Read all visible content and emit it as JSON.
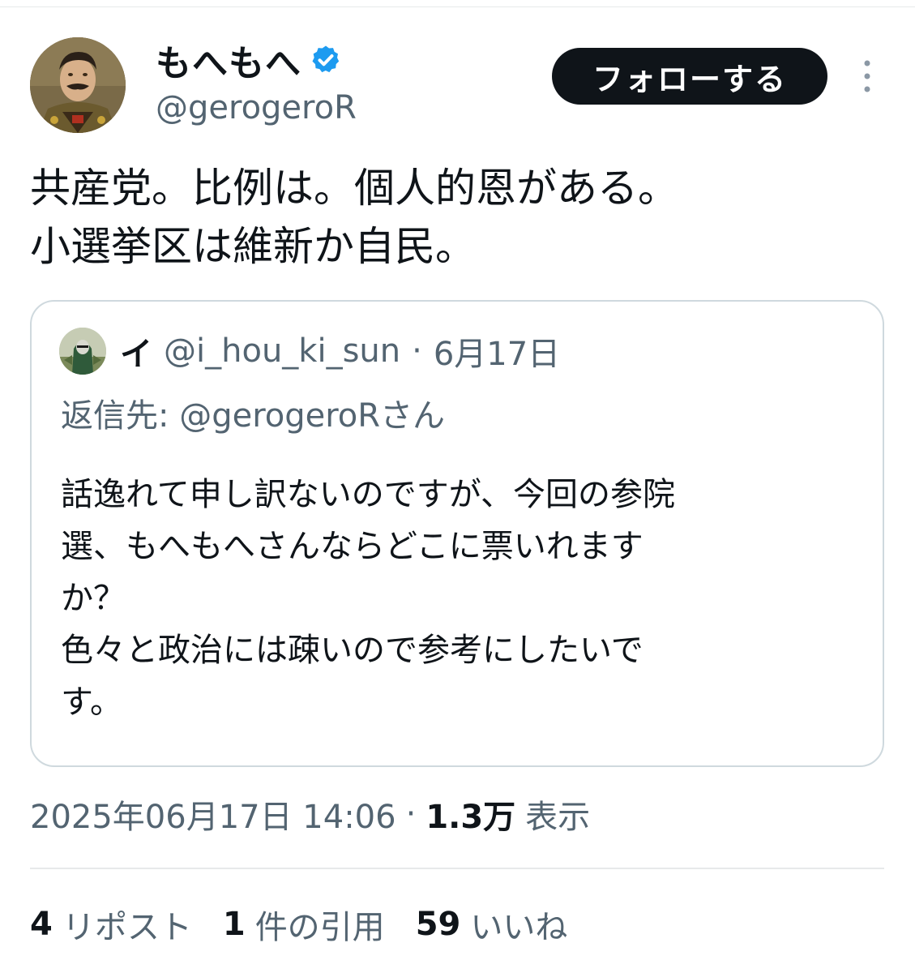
{
  "author": {
    "display_name": "もへもへ",
    "handle": "@gerogeroR",
    "verified": true,
    "avatar_icon": "portrait-avatar"
  },
  "follow_label": "フォローする",
  "more_icon": "more-vertical-icon",
  "tweet_text": "共産党。比例は。個人的恩がある。\n小選挙区は維新か自民。",
  "quote": {
    "display_name": "イ",
    "handle": "@i_hou_ki_sun",
    "separator": "·",
    "date": "6月17日",
    "reply_to": "返信先: @gerogeroRさん",
    "text": "話逸れて申し訳ないのですが、今回の参院\n選、もへもへさんならどこに票いれます\nか？\n色々と政治には疎いので参考にしたいで\nす。"
  },
  "meta": {
    "timestamp": "2025年06月17日 14:06",
    "separator": "·",
    "views_count": "1.3万",
    "views_label": "表示"
  },
  "stats": {
    "reposts_count": "4",
    "reposts_label": "リポスト",
    "quotes_count": "1",
    "quotes_label": "件の引用",
    "likes_count": "59",
    "likes_label": "いいね"
  },
  "colors": {
    "text_primary": "#0f1419",
    "text_secondary": "#536471",
    "verified_blue": "#1d9bf0",
    "border": "#cfd9de"
  }
}
